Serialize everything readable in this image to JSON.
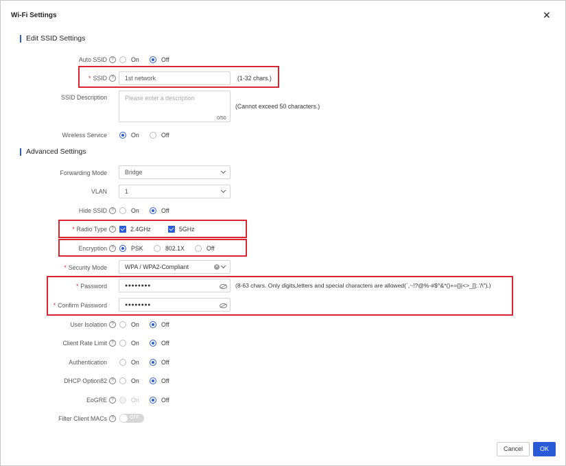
{
  "dialog": {
    "title": "Wi-Fi Settings",
    "close_glyph": "✕",
    "cancel_label": "Cancel",
    "ok_label": "OK"
  },
  "sections": {
    "edit_ssid": "Edit SSID Settings",
    "advanced": "Advanced Settings"
  },
  "common": {
    "on": "On",
    "off": "Off",
    "help": "?",
    "required": "*"
  },
  "fields": {
    "auto_ssid": {
      "label": "Auto SSID",
      "selected": "Off"
    },
    "ssid": {
      "label": "SSID",
      "value": "1st network",
      "hint": "(1-32 chars.)"
    },
    "ssid_description": {
      "label": "SSID Description",
      "placeholder": "Please enter a description",
      "counter": "0/50",
      "hint": "(Cannot exceed 50 characters.)"
    },
    "wireless_service": {
      "label": "Wireless Service",
      "selected": "On"
    },
    "forwarding_mode": {
      "label": "Forwarding Mode",
      "value": "Bridge"
    },
    "vlan": {
      "label": "VLAN",
      "value": "1"
    },
    "hide_ssid": {
      "label": "Hide SSID",
      "selected": "Off"
    },
    "radio_type": {
      "label": "Radio Type",
      "options": [
        "2.4GHz",
        "5GHz"
      ],
      "checked": [
        "2.4GHz",
        "5GHz"
      ]
    },
    "encryption": {
      "label": "Encryption",
      "options": [
        "PSK",
        "802.1X",
        "Off"
      ],
      "selected": "PSK"
    },
    "security_mode": {
      "label": "Security Mode",
      "value": "WPA / WPA2-Compliant"
    },
    "password": {
      "label": "Password",
      "value": "●●●●●●●●",
      "hint": "(8-63 chars. Only digits,letters and special characters are allowed(`,~!?@%-#$^&*()+={}|<>_[];.'/\\\").)"
    },
    "confirm_password": {
      "label": "Confirm Password",
      "value": "●●●●●●●●"
    },
    "user_isolation": {
      "label": "User Isolation",
      "selected": "Off"
    },
    "client_rate_limit": {
      "label": "Client Rate Limit",
      "selected": "Off"
    },
    "authentication": {
      "label": "Authentication",
      "selected": "Off"
    },
    "dhcp_option82": {
      "label": "DHCP Option82",
      "selected": "Off"
    },
    "eogre": {
      "label": "EoGRE",
      "selected": "Off",
      "on_disabled": true
    },
    "filter_client_macs": {
      "label": "Filter Client MACs",
      "toggle_text": "OFF",
      "enabled": false
    }
  },
  "colors": {
    "accent": "#2a5bd7",
    "highlight": "#d9232e",
    "required": "#e0282e"
  }
}
